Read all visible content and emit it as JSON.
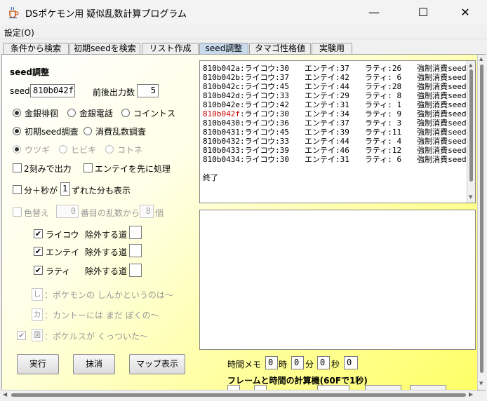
{
  "window": {
    "title": "DSポケモン用 疑似乱数計算プログラム",
    "minimize": "—",
    "maximize": "☐",
    "close": "✕"
  },
  "menu": {
    "settings": "設定(O)"
  },
  "tabs": [
    "条件から検索",
    "初期seedを検索",
    "リスト作成",
    "seed調整",
    "タマゴ性格値",
    "実験用"
  ],
  "active_tab": "seed調整",
  "left": {
    "section_title": "seed調整",
    "seed_label": "seed",
    "seed_value": "810b042f",
    "output_count_label": "前後出力数",
    "output_count_value": "5",
    "mode_options": [
      "金銀徘徊",
      "金銀電話",
      "コイントス"
    ],
    "mode_selected": "金銀徘徊",
    "check_options": [
      "初期seed調査",
      "消費乱数調査"
    ],
    "check_selected": "初期seed調査",
    "phone_options": [
      "ウツギ",
      "ヒビキ",
      "コトネ"
    ],
    "phone_selected": "ウツギ",
    "two_step_label": "2刻みで出力",
    "entei_first_label": "エンテイを先に処理",
    "minsec_label_a": "分＋秒が",
    "minsec_value": "1",
    "minsec_label_b": "ずれた分も表示",
    "color_label": "色替え",
    "color_start": "0",
    "color_mid": "番目の乱数から",
    "color_count": "8",
    "color_unit": "個",
    "beasts": [
      {
        "name": "ライコウ",
        "exclude": "除外する道",
        "checked": true
      },
      {
        "name": "エンテイ",
        "exclude": "除外する道",
        "checked": true
      },
      {
        "name": "ラティ",
        "exclude": "除外する道",
        "checked": true
      }
    ],
    "lines": [
      {
        "icon": "し",
        "text": "：ポケモンの しんかというのは～"
      },
      {
        "icon": "カ",
        "text": "：カントーには まだ ぼくの～"
      },
      {
        "icon": "菌",
        "text": "：ポケルスが くっついた～"
      }
    ],
    "buttons": {
      "run": "実行",
      "clear": "抹消",
      "map": "マップ表示"
    }
  },
  "results": {
    "lines": [
      "810b042a:ライコウ:30　　エンテイ:37　　ラティ:26　　強制消費seed数:3",
      "810b042b:ライコウ:37　　エンテイ:42　　ラティ: 6　　強制消費seed数:3",
      "810b042c:ライコウ:45　　エンテイ:44　　ラティ:28　　強制消費seed数:3",
      "810b042d:ライコウ:33　　エンテイ:29　　ラティ: 8　　強制消費seed数:3",
      "810b042e:ライコウ:42　　エンテイ:31　　ラティ: 1　　強制消費seed数:3",
      "810b042f:ライコウ:30　　エンテイ:34　　ラティ: 9　　強制消費seed数:3",
      "810b0430:ライコウ:36　　エンテイ:37　　ラティ: 3　　強制消費seed数:3",
      "810b0431:ライコウ:45　　エンテイ:39　　ラティ:11　　強制消費seed数:3",
      "810b0432:ライコウ:33　　エンテイ:44　　ラティ: 4　　強制消費seed数:3",
      "810b0433:ライコウ:39　　エンテイ:46　　ラティ:12　　強制消費seed数:3",
      "810b0434:ライコウ:30　　エンテイ:31　　ラティ: 6　　強制消費seed数:3"
    ],
    "highlight_seed": "810b042f",
    "highlight_color": "#cc0000",
    "end_text": "終了"
  },
  "time_memo": {
    "label": "時間メモ",
    "hour_value": "0",
    "hour_unit": "時",
    "min_value": "0",
    "min_unit": "分",
    "sec_value": "0",
    "sec_unit": "秒",
    "extra_value": "0"
  },
  "frame_calc": {
    "title": "フレームと時間の計算機(60Fで1秒)"
  }
}
